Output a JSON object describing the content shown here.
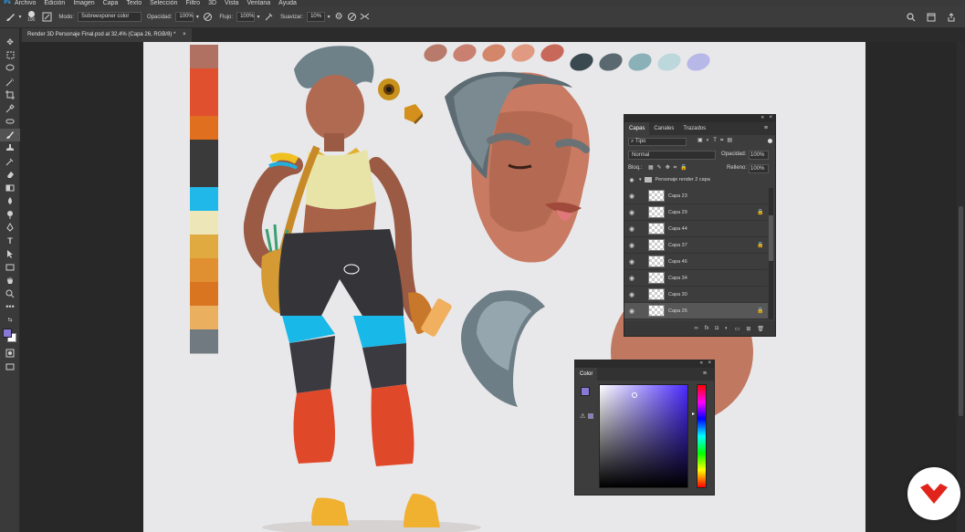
{
  "menu": {
    "app": "Ps",
    "items": [
      "Archivo",
      "Edición",
      "Imagen",
      "Capa",
      "Texto",
      "Selección",
      "Filtro",
      "3D",
      "Vista",
      "Ventana",
      "Ayuda"
    ]
  },
  "options": {
    "size": "100",
    "mode_label": "Modo:",
    "mode_value": "Sobreexponer color",
    "opacity_label": "Opacidad:",
    "opacity_value": "100%",
    "flow_label": "Flujo:",
    "flow_value": "100%",
    "smoothing_label": "Suavizar:",
    "smoothing_value": "10%"
  },
  "document": {
    "tab_title": "Render 3D Personaje Final.psd al 32,4% (Capa 26, RGB/8) *",
    "close": "×"
  },
  "layers_panel": {
    "tabs": [
      "Capas",
      "Canales",
      "Trazados"
    ],
    "filter_kind": "Tipo",
    "blend_mode": "Normal",
    "opacity_label": "Opacidad:",
    "opacity_value": "100%",
    "lock_label": "Bloq.:",
    "fill_label": "Relleno:",
    "fill_value": "100%",
    "group_name": "Personaje render 2 capa",
    "layers": [
      {
        "name": "Capa 23",
        "locked": false,
        "selected": false
      },
      {
        "name": "Capa 29",
        "locked": true,
        "selected": false
      },
      {
        "name": "Capa 44",
        "locked": false,
        "selected": false
      },
      {
        "name": "Capa 37",
        "locked": true,
        "selected": false
      },
      {
        "name": "Capa 46",
        "locked": false,
        "selected": false
      },
      {
        "name": "Capa 34",
        "locked": false,
        "selected": false
      },
      {
        "name": "Capa 30",
        "locked": false,
        "selected": false
      },
      {
        "name": "Capa 26",
        "locked": true,
        "selected": true
      }
    ]
  },
  "color_panel": {
    "title": "Color",
    "foreground": "#8878d8",
    "hue_color": "#4a2bff"
  },
  "palette": {
    "strip": [
      "#b07062",
      "#e0502e",
      "#e0502e",
      "#e07020",
      "#3a3a3a",
      "#3a3a3a",
      "#20b8e8",
      "#ece6b8",
      "#e0aa40",
      "#e09030",
      "#d97420",
      "#eab060",
      "#707a80"
    ],
    "top_swatches": [
      "#b87a6a",
      "#c98070",
      "#d4866a",
      "#e09a82",
      "#c8685a",
      "#3a4850",
      "#5a6870",
      "#8ab0b8",
      "#bcd8dc",
      "#b8b8e8"
    ]
  },
  "icons": {
    "brush": "brush-icon",
    "search": "search-icon",
    "workspace": "workspace-icon",
    "share": "share-icon",
    "eye": "eye-icon",
    "lock": "lock-icon",
    "folder": "folder-icon",
    "logo": "logo-icon"
  }
}
